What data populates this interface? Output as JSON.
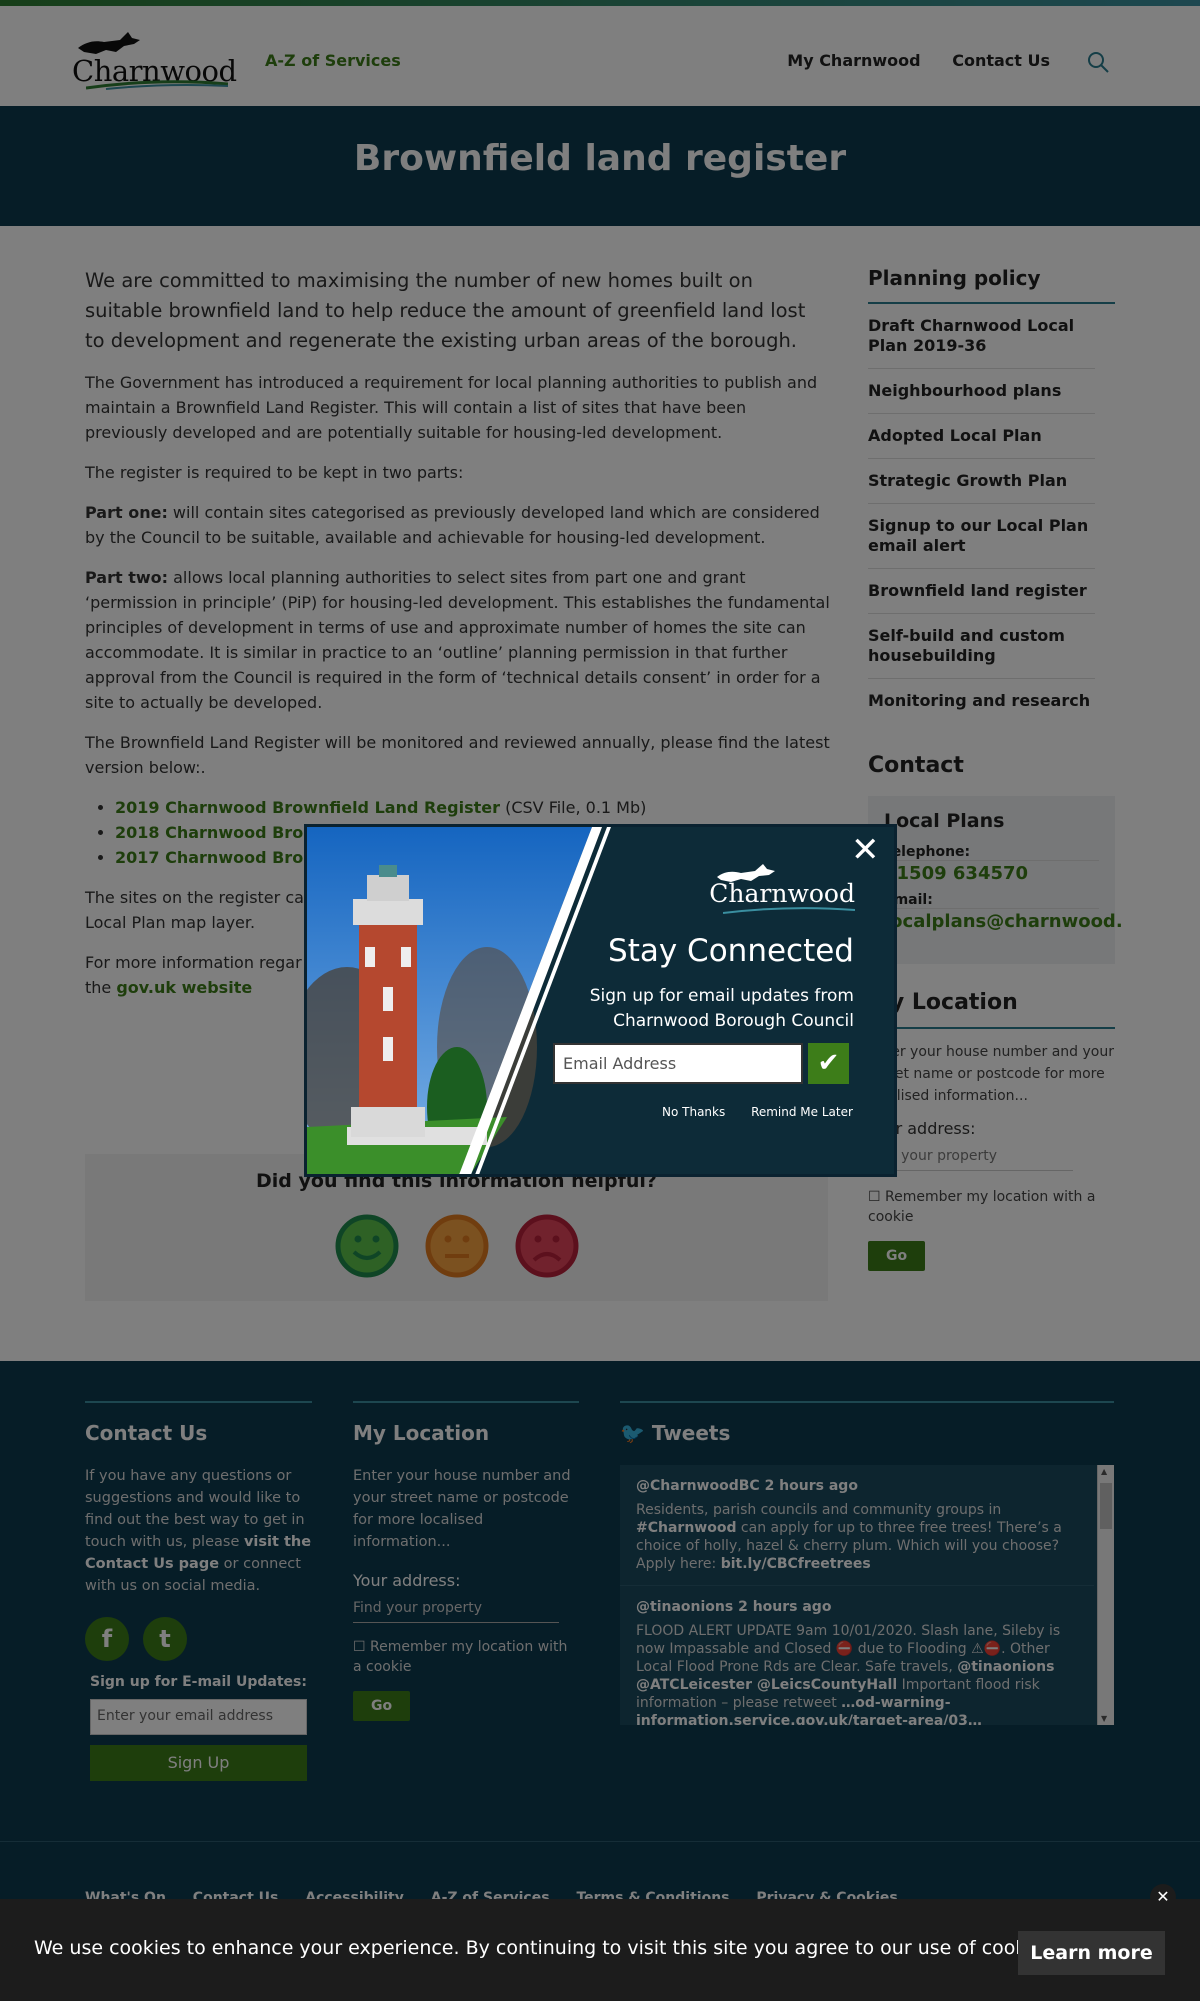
{
  "header": {
    "logo_text": "Charnwood",
    "nav_az": "A-Z of Services",
    "nav_my": "My Charnwood",
    "nav_contact": "Contact Us"
  },
  "hero": {
    "title": "Brownfield land register"
  },
  "content": {
    "lead": "We are committed to maximising the number of new homes built on suitable brownfield land to help reduce the amount of greenfield land lost to development and regenerate the existing urban areas of the borough.",
    "p1": "The Government has introduced a requirement for local planning authorities to publish and maintain a Brownfield Land Register. This will contain a list of sites that have been previously developed and are potentially suitable for housing-led development.",
    "p2": "The register is required to be kept in two parts:",
    "part_one_label": "Part one:",
    "part_one_text": " will contain sites categorised as previously developed land which are considered by the Council to be suitable, available and achievable for housing-led development.",
    "part_two_label": "Part two:",
    "part_two_text": " allows local planning authorities to select sites from part one and grant ‘permission in principle’ (PiP) for housing-led development. This establishes the fundamental principles of development in terms of use and approximate number of homes the site can accommodate. It is similar in practice to an ‘outline’ planning permission in that further approval from the Council is required in the form of ‘technical details consent’ in order for a site to actually be developed.",
    "p5": "The Brownfield Land Register will be monitored and reviewed annually, please find the latest version below:.",
    "files": [
      {
        "link": "2019 Charnwood Brownfield Land Register",
        "meta": " (CSV File, 0.1 Mb)"
      },
      {
        "link": "2018 Charnwood Bro",
        "meta": ""
      },
      {
        "link": "2017 Charnwood Bro",
        "meta": ""
      }
    ],
    "p6_a": "The sites on the register ca",
    "p6_b": "Local Plan map layer.",
    "p7_a": "For more information regar",
    "p7_b": "the ",
    "p7_link": "gov.uk website"
  },
  "feedback": {
    "title": "Did you find this information helpful?"
  },
  "sidebar": {
    "title": "Planning policy",
    "items": [
      "Draft Charnwood Local Plan 2019-36",
      "Neighbourhood plans",
      "Adopted Local Plan",
      "Strategic Growth Plan",
      "Signup to our Local Plan email alert",
      "Brownfield land register",
      "Self-build and custom housebuilding",
      "Monitoring and research"
    ],
    "contact_title": "Contact",
    "box_title": "Local Plans",
    "tel_label": "Telephone:",
    "tel": "01509 634570",
    "email_label": "Email:",
    "email": "localplans@charnwood.",
    "loc_title": "My Location",
    "loc_text": "Enter your house number and your street name or postcode for more localised information...",
    "addr_label": "Your address:",
    "addr_placeholder": "Find your property",
    "remember": "Remember my location with a cookie",
    "go": "Go"
  },
  "footer": {
    "contact_title": "Contact Us",
    "contact_p1": "If you have any questions or suggestions and would like to find out the best way to get in touch with us, please ",
    "contact_link": "visit the Contact Us page",
    "contact_p2": " or connect with us on social media.",
    "signup_label": "Sign up for E-mail Updates:",
    "signup_placeholder": "Enter your email address",
    "signup_btn": "Sign Up",
    "loc_title": "My Location",
    "loc_text": "Enter your house number and your street name or postcode for more localised information...",
    "addr_label": "Your address:",
    "addr_placeholder": "Find your property",
    "remember": "Remember my location with a cookie",
    "go": "Go",
    "tweets_title": "Tweets",
    "tweets": [
      {
        "head": "@CharnwoodBC 2 hours ago",
        "body_a": "Residents, parish councils and community groups in ",
        "tag": "#Charnwood",
        "body_b": " can apply for up to three free trees! There’s a choice of holly, hazel & cherry plum. Which will you choose? Apply here: ",
        "link": "bit.ly/CBCfreetrees"
      },
      {
        "head": "@tinaonions 2 hours ago",
        "body_a": "FLOOD ALERT UPDATE 9am 10/01/2020. Slash lane, Sileby is now Impassable and Closed ⛔ due to Flooding ⚠⛔. Other Local Flood Prone Rds are Clear. Safe travels, ",
        "tag": "@tinaonions @ATCLeicester @LeicsCountyHall",
        "body_b": " Important flood risk information – please retweet ",
        "link": "…od-warning-information.service.gov.uk/target-area/03…"
      }
    ],
    "bottom_links": [
      "What's On",
      "Contact Us",
      "Accessibility",
      "A-Z of Services",
      "Terms & Conditions",
      "Privacy & Cookies"
    ]
  },
  "modal": {
    "logo_text": "Charnwood",
    "title": "Stay Connected",
    "subtitle": "Sign up for email updates from Charnwood Borough Council",
    "email_placeholder": "Email Address",
    "no_thanks": "No Thanks",
    "remind": "Remind Me Later"
  },
  "cookie": {
    "text": "We use cookies to enhance your experience. By continuing to visit this site you agree to our use of cookies.",
    "button": "Learn more"
  }
}
